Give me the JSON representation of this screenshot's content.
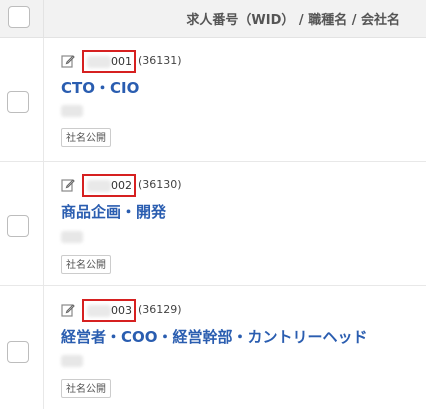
{
  "header": {
    "title": "求人番号（WID） / 職種名 / 会社名"
  },
  "jobs": [
    {
      "wid_suffix": "001",
      "wid_number": "(36131)",
      "title": "CTO・CIO",
      "badge": "社名公開"
    },
    {
      "wid_suffix": "002",
      "wid_number": "(36130)",
      "title": "商品企画・開発",
      "badge": "社名公開"
    },
    {
      "wid_suffix": "003",
      "wid_number": "(36129)",
      "title": "経営者・COO・経営幹部・カントリーヘッド",
      "badge": "社名公開"
    }
  ],
  "icons": {
    "edit": "pencil-edit-icon",
    "checkbox": "checkbox-icon"
  },
  "colors": {
    "title_link": "#2a5db0",
    "highlight_box": "#d62020",
    "header_bg": "#f2f2f2"
  }
}
